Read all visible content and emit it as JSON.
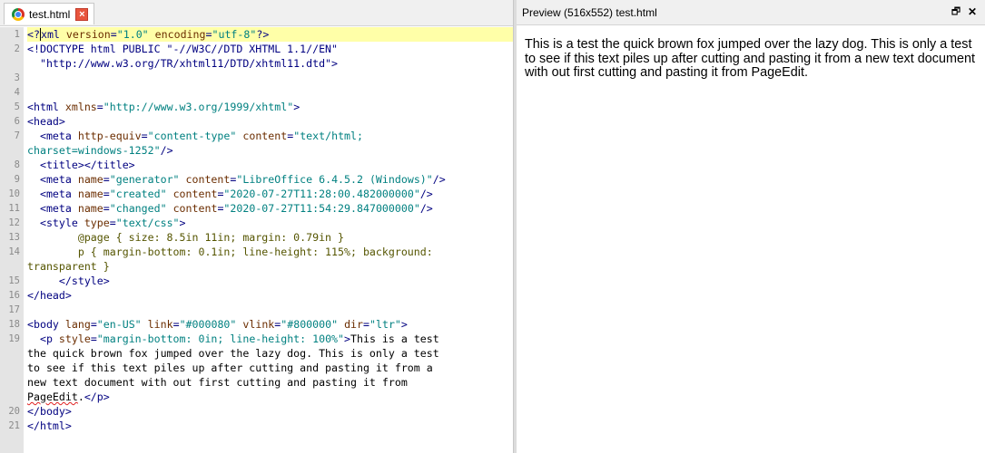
{
  "editor": {
    "tab": {
      "label": "test.html",
      "close_glyph": "×"
    },
    "lines": [
      {
        "n": "1",
        "parts": [
          [
            "tag",
            "<?"
          ],
          [
            "cursor",
            "x"
          ],
          [
            "tag",
            "ml "
          ],
          [
            "attr",
            "version"
          ],
          [
            "tag",
            "="
          ],
          [
            "val",
            "\"1.0\""
          ],
          [
            "tag",
            " "
          ],
          [
            "attr",
            "encoding"
          ],
          [
            "tag",
            "="
          ],
          [
            "val",
            "\"utf-8\""
          ],
          [
            "tag",
            "?>"
          ]
        ],
        "hl": true
      },
      {
        "n": "2",
        "parts": [
          [
            "tag",
            "<!DOCTYPE html PUBLIC \"-//W3C//DTD XHTML 1.1//EN\""
          ]
        ]
      },
      {
        "n": "",
        "parts": [
          [
            "tag",
            "  \"http://www.w3.org/TR/xhtml11/DTD/xhtml11.dtd\">"
          ]
        ]
      },
      {
        "n": "3",
        "parts": []
      },
      {
        "n": "4",
        "parts": []
      },
      {
        "n": "5",
        "parts": [
          [
            "tag",
            "<html "
          ],
          [
            "attr",
            "xmlns"
          ],
          [
            "tag",
            "="
          ],
          [
            "val",
            "\"http://www.w3.org/1999/xhtml\""
          ],
          [
            "tag",
            ">"
          ]
        ]
      },
      {
        "n": "6",
        "parts": [
          [
            "tag",
            "<head>"
          ]
        ]
      },
      {
        "n": "7",
        "parts": [
          [
            "tag",
            "  <meta "
          ],
          [
            "attr",
            "http-equiv"
          ],
          [
            "tag",
            "="
          ],
          [
            "val",
            "\"content-type\""
          ],
          [
            "tag",
            " "
          ],
          [
            "attr",
            "content"
          ],
          [
            "tag",
            "="
          ],
          [
            "val",
            "\"text/html;"
          ]
        ]
      },
      {
        "n": "",
        "parts": [
          [
            "val",
            "charset=windows-1252\""
          ],
          [
            "tag",
            "/>"
          ]
        ]
      },
      {
        "n": "8",
        "parts": [
          [
            "tag",
            "  <title></title>"
          ]
        ]
      },
      {
        "n": "9",
        "parts": [
          [
            "tag",
            "  <meta "
          ],
          [
            "attr",
            "name"
          ],
          [
            "tag",
            "="
          ],
          [
            "val",
            "\"generator\""
          ],
          [
            "tag",
            " "
          ],
          [
            "attr",
            "content"
          ],
          [
            "tag",
            "="
          ],
          [
            "val",
            "\"LibreOffice 6.4.5.2 (Windows)\""
          ],
          [
            "tag",
            "/>"
          ]
        ]
      },
      {
        "n": "10",
        "parts": [
          [
            "tag",
            "  <meta "
          ],
          [
            "attr",
            "name"
          ],
          [
            "tag",
            "="
          ],
          [
            "val",
            "\"created\""
          ],
          [
            "tag",
            " "
          ],
          [
            "attr",
            "content"
          ],
          [
            "tag",
            "="
          ],
          [
            "val",
            "\"2020-07-27T11:28:00.482000000\""
          ],
          [
            "tag",
            "/>"
          ]
        ]
      },
      {
        "n": "11",
        "parts": [
          [
            "tag",
            "  <meta "
          ],
          [
            "attr",
            "name"
          ],
          [
            "tag",
            "="
          ],
          [
            "val",
            "\"changed\""
          ],
          [
            "tag",
            " "
          ],
          [
            "attr",
            "content"
          ],
          [
            "tag",
            "="
          ],
          [
            "val",
            "\"2020-07-27T11:54:29.847000000\""
          ],
          [
            "tag",
            "/>"
          ]
        ]
      },
      {
        "n": "12",
        "parts": [
          [
            "tag",
            "  <style "
          ],
          [
            "attr",
            "type"
          ],
          [
            "tag",
            "="
          ],
          [
            "val",
            "\"text/css\""
          ],
          [
            "tag",
            ">"
          ]
        ]
      },
      {
        "n": "13",
        "parts": [
          [
            "css",
            "        @page { size: 8.5in 11in; margin: 0.79in }"
          ]
        ]
      },
      {
        "n": "14",
        "parts": [
          [
            "css",
            "        p { margin-bottom: 0.1in; line-height: 115%; background:"
          ]
        ]
      },
      {
        "n": "",
        "parts": [
          [
            "css",
            "transparent }"
          ]
        ]
      },
      {
        "n": "15",
        "parts": [
          [
            "tag",
            "     </style>"
          ]
        ]
      },
      {
        "n": "16",
        "parts": [
          [
            "tag",
            "</head>"
          ]
        ]
      },
      {
        "n": "17",
        "parts": []
      },
      {
        "n": "18",
        "parts": [
          [
            "tag",
            "<body "
          ],
          [
            "attr",
            "lang"
          ],
          [
            "tag",
            "="
          ],
          [
            "val",
            "\"en-US\""
          ],
          [
            "tag",
            " "
          ],
          [
            "attr",
            "link"
          ],
          [
            "tag",
            "="
          ],
          [
            "val",
            "\"#000080\""
          ],
          [
            "tag",
            " "
          ],
          [
            "attr",
            "vlink"
          ],
          [
            "tag",
            "="
          ],
          [
            "val",
            "\"#800000\""
          ],
          [
            "tag",
            " "
          ],
          [
            "attr",
            "dir"
          ],
          [
            "tag",
            "="
          ],
          [
            "val",
            "\"ltr\""
          ],
          [
            "tag",
            ">"
          ]
        ]
      },
      {
        "n": "19",
        "parts": [
          [
            "tag",
            "  <p "
          ],
          [
            "attr",
            "style"
          ],
          [
            "tag",
            "="
          ],
          [
            "val",
            "\"margin-bottom: 0in; line-height: 100%\""
          ],
          [
            "tag",
            ">"
          ],
          [
            "text",
            "This is a test"
          ]
        ]
      },
      {
        "n": "",
        "parts": [
          [
            "text",
            "the quick brown fox jumped over the lazy dog. This is only a test"
          ]
        ]
      },
      {
        "n": "",
        "parts": [
          [
            "text",
            "to see if this text piles up after cutting and pasting it from a"
          ]
        ]
      },
      {
        "n": "",
        "parts": [
          [
            "text",
            "new text document with out first cutting and pasting it from"
          ]
        ]
      },
      {
        "n": "",
        "parts": [
          [
            "squig",
            "PageEdit"
          ],
          [
            "text",
            "."
          ],
          [
            "tag",
            "</p>"
          ]
        ]
      },
      {
        "n": "20",
        "parts": [
          [
            "tag",
            "</body>"
          ]
        ]
      },
      {
        "n": "21",
        "parts": [
          [
            "tag",
            "</html>"
          ]
        ]
      }
    ]
  },
  "preview": {
    "title": "Preview (516x552) test.html",
    "float_glyph": "🗗",
    "close_glyph": "✕",
    "body_text": "This is a test the quick brown fox jumped over the lazy dog. This is only a test to see if this text piles up after cutting and pasting it from a new text document with out first cutting and pasting it from PageEdit."
  },
  "colors": {
    "tag": "#000080",
    "attribute": "#6b2d00",
    "value": "#008080",
    "css": "#555500",
    "current_line": "#ffffa8",
    "gutter": "#e4e4e4",
    "tab_close": "#e8553d"
  },
  "icons": {
    "tab_icon": "browser-icon",
    "tab_close": "close-icon",
    "float": "float-window-icon",
    "close": "close-icon"
  }
}
